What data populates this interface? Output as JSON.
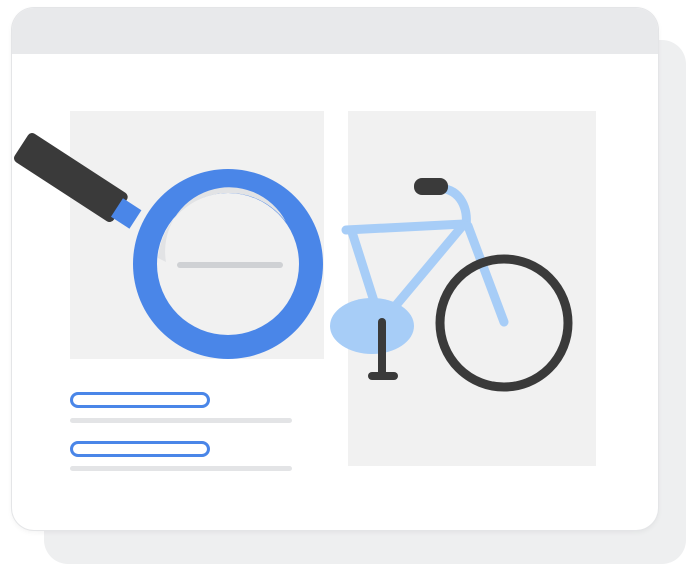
{
  "icons": {
    "magnifier": "magnifier-icon",
    "bicycle": "bicycle-icon"
  },
  "colors": {
    "accent_blue": "#4a86e8",
    "light_blue": "#a7cdf7",
    "dark": "#3a3a3a",
    "panel_gray": "#f1f1f1",
    "bar_gray": "#e8e9eb"
  }
}
